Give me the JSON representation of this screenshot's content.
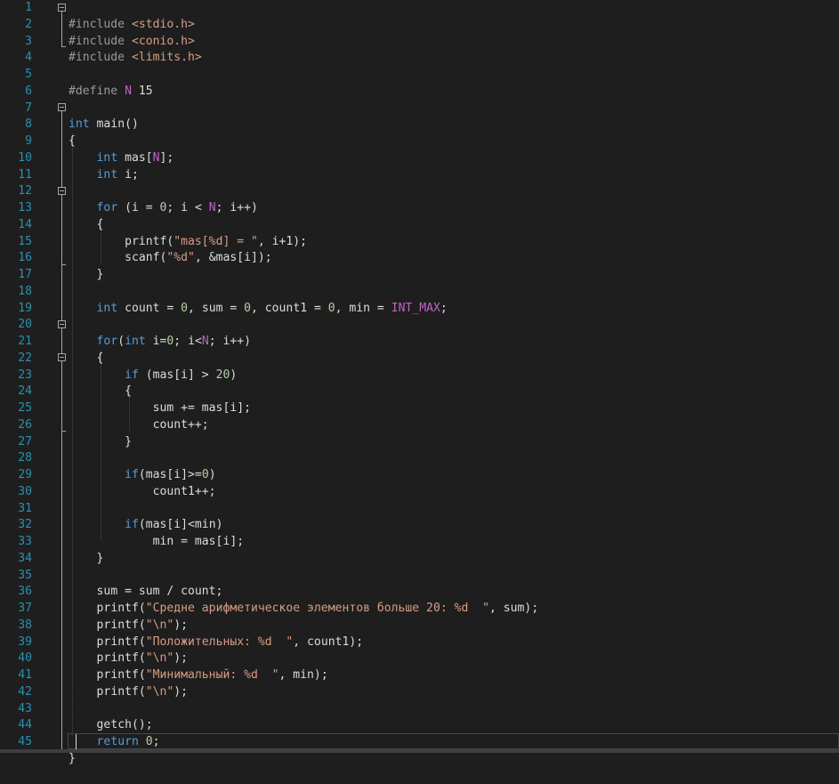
{
  "editor": {
    "language": "C",
    "colors": {
      "background": "#1e1e1e",
      "line_number": "#2b91af",
      "keyword": "#569cd6",
      "string": "#d69d85",
      "number": "#b5cea8",
      "macro": "#bd63c5",
      "text": "#dcdcdc"
    },
    "line_numbers": [
      "1",
      "2",
      "3",
      "4",
      "5",
      "6",
      "7",
      "8",
      "9",
      "10",
      "11",
      "12",
      "13",
      "14",
      "15",
      "16",
      "17",
      "18",
      "19",
      "20",
      "21",
      "22",
      "23",
      "24",
      "25",
      "26",
      "27",
      "28",
      "29",
      "30",
      "31",
      "32",
      "33",
      "34",
      "35",
      "36",
      "37",
      "38",
      "39",
      "40",
      "41",
      "42",
      "43",
      "44",
      "45"
    ],
    "t": {
      "inc_kw": "#include",
      "stdio": "<stdio.h>",
      "conio": "<conio.h>",
      "limits": "<limits.h>",
      "define_kw": "#define",
      "N": "N",
      "n15": "15",
      "int": "int",
      "main_sig": " main()",
      "lbrace": "{",
      "rbrace": "}",
      "mas_decl_a": " mas[",
      "mas_decl_b": "];",
      "i_decl": " i;",
      "for": "for",
      "for1_a": " (i = ",
      "zero": "0",
      "for1_b": "; i < ",
      "for1_c": "; i++)",
      "printf": "printf(",
      "str_mas": "\"mas[%d] = \"",
      "printf1_tail": ", i+1);",
      "scanf": "scanf(",
      "str_pd": "\"%d\"",
      "scanf_tail": ", &mas[i]);",
      "count_a": " count = ",
      "count_b": ", sum = ",
      "count_c": ", count1 = ",
      "count_d": ", min = ",
      "INT_MAX": "INT_MAX",
      "semi": ";",
      "for2_a": "(",
      "for2_b": " i=",
      "for2_c": "; i<",
      "for2_d": "; i++)",
      "if": "if",
      "if1_a": " (mas[i] > ",
      "n20": "20",
      "rparen": ")",
      "sum_plus": "sum += mas[i];",
      "count_pp": "count++;",
      "if2_a": "(mas[i]>=",
      "count1_pp": "count1++;",
      "if3": "(mas[i]<min)",
      "min_assign": "min = mas[i];",
      "sum_div": "sum = sum / count;",
      "str_avg": "\"Средне арифметическое элементов больше 20: %d  \"",
      "avg_tail": ", sum);",
      "str_nl": "\"\\n\"",
      "nl_tail": ");",
      "str_pos": "\"Положительных: %d  \"",
      "pos_tail": ", count1);",
      "str_min": "\"Минимальный: %d  \"",
      "min_tail": ", min);",
      "getch": "getch();",
      "return": "return",
      "ret_tail": ";"
    }
  }
}
